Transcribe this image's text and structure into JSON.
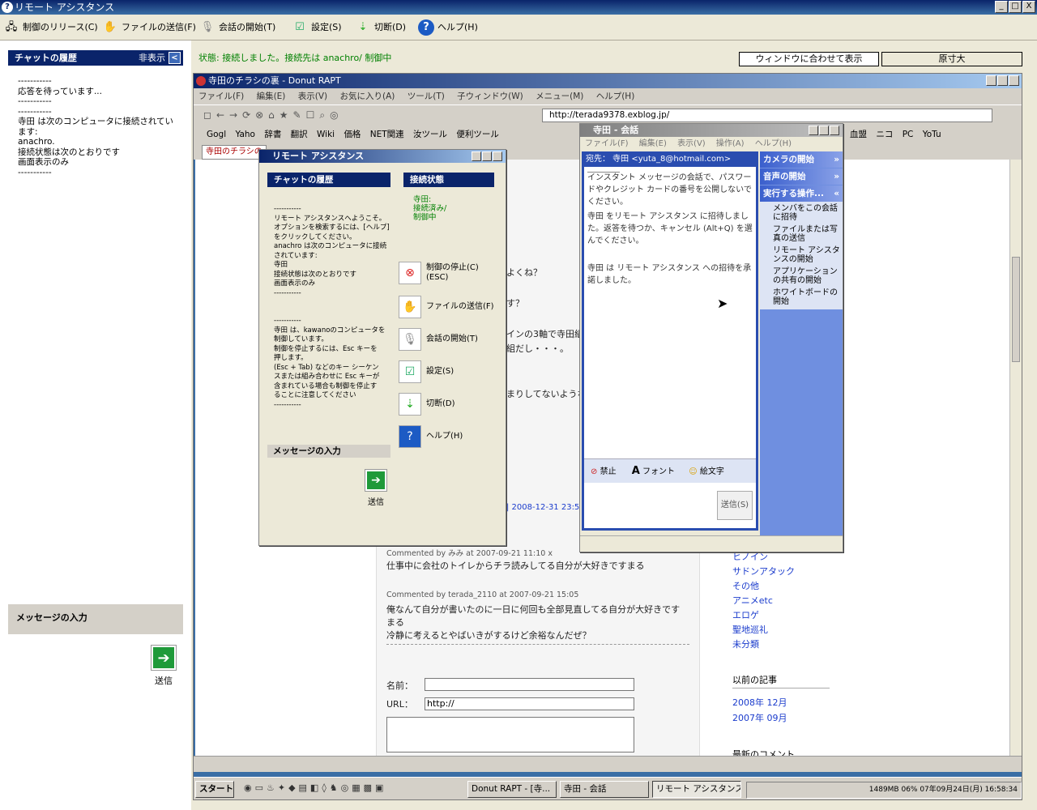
{
  "window": {
    "title": "リモート アシスタンス",
    "min": "_",
    "max": "□",
    "close": "X"
  },
  "main_toolbar": {
    "release": "制御のリリース(C)",
    "send_file": "ファイルの送信(F)",
    "start_conv": "会話の開始(T)",
    "settings": "設定(S)",
    "disconnect": "切断(D)",
    "help": "ヘルプ(H)"
  },
  "left_panel": {
    "header": "チャットの履歴",
    "hide": "非表示",
    "hide_arrow": "<",
    "chat_log": "-----------\n応答を待っています...\n-----------\n-----------\n寺田 は次のコンピュータに接続されています:\nanachro.\n接続状態は次のとおりです\n画面表示のみ\n-----------",
    "message_header": "メッセージの入力",
    "send_label": "送信",
    "send_arrow": "➔"
  },
  "status": {
    "text": "状態: 接続しました。接続先は anachro/ 制御中",
    "fit_button": "ウィンドウに合わせて表示",
    "actual_button": "原寸大"
  },
  "donut": {
    "title": "寺田のチラシの裏 - Donut RAPT",
    "menu": [
      "ファイル(F)",
      "編集(E)",
      "表示(V)",
      "お気に入り(A)",
      "ツール(T)",
      "子ウィンドウ(W)",
      "メニュー(M)",
      "ヘルプ(H)"
    ],
    "address": "http://terada9378.exblog.jp/",
    "links": [
      "Gogl",
      "Yaho",
      "辞書",
      "翻訳",
      "Wiki",
      "価格",
      "NET関連",
      "汝ツール",
      "便利ツール",
      "血盟",
      "ニコ",
      "PC",
      "YoTu"
    ],
    "tab": "寺田のチラシの裏",
    "page_fragments": {
      "f1": "よくね？",
      "f2": "す？",
      "f3": "インの3軸で寺田組",
      "f4": "組だし・・・。",
      "f5": "まりしてないような",
      "date_link": "| 2008-12-31 23:59 | モ"
    },
    "comments": [
      {
        "by": "Commented by みみ at 2007-09-21 11:10 x",
        "text": "仕事中に会社のトイレからチラ読みしてる自分が大好きですまる"
      },
      {
        "by": "Commented by terada_2110 at 2007-09-21 15:05",
        "text": "俺なんて自分が書いたのに一日に何回も全部見直してる自分が大好きです　まる\n冷静に考えるとやばいきがするけど余裕なんだぜ？"
      }
    ],
    "form": {
      "name_label": "名前：",
      "url_label": "URL：",
      "url_value": "http://"
    },
    "categories": [
      "ヒノイン",
      "サドンアタック",
      "その他",
      "アニメetc",
      "エロゲ",
      "聖地巡礼",
      "未分類"
    ],
    "archive_title": "以前の記事",
    "archives": [
      "2008年 12月",
      "2007年 09月"
    ],
    "recent_comments": "最新のコメント"
  },
  "taskbar": {
    "start": "スタート",
    "tasks": [
      "Donut RAPT - [寺...",
      "寺田 - 会話",
      "リモート アシスタンス"
    ],
    "tray": "1489MB  06%  07年09月24日(月) 16:58:34"
  },
  "ra_inner": {
    "title": "リモート アシスタンス",
    "chat_header": "チャットの履歴",
    "status_header": "接続状態",
    "status_text": "寺田:\n接続済み/\n制御中",
    "chat_log": "-----------\nリモート アシスタンスへようこそ。\nオプションを検索するには、[ヘルプ]\nをクリックしてください。\nanachro は次のコンピュータに接続\nされています:\n寺田\n接続状態は次のとおりです\n画面表示のみ\n-----------\n\n\n-----------\n寺田 は、kawanoのコンピュータを\n制御しています。\n制御を停止するには、Esc キーを\n押します。\n(Esc + Tab) などのキー シーケン\nスまたは組み合わせに Esc キーが\n含まれている場合も制御を停止す\nることに注意してください\n-----------",
    "buttons": [
      "制御の停止(C)\n(ESC)",
      "ファイルの送信(F)",
      "会話の開始(T)",
      "設定(S)",
      "切断(D)",
      "ヘルプ(H)"
    ],
    "msg_header": "メッセージの入力",
    "send": "送信"
  },
  "conversation": {
    "title": "寺田 - 会話",
    "menu": [
      "ファイル(F)",
      "編集(E)",
      "表示(V)",
      "操作(A)",
      "ヘルプ(H)"
    ],
    "to": "宛先： 寺田 <yuta_8@hotmail.com>",
    "messages": [
      "インスタント メッセージの会話で、パスワードやクレジット カードの番号を公開しないでください。",
      "寺田 をリモート アシスタンス に招待しました。返答を待つか、キャンセル (Alt+Q) を選んでください。",
      "寺田 は リモート アシスタンス への招待を承諾しました。"
    ],
    "block": "禁止",
    "font": "フォント",
    "emoticon": "絵文字",
    "send": "送信(S)",
    "side": {
      "camera": "カメラの開始",
      "voice": "音声の開始",
      "actions": "実行する操作...",
      "items": [
        "メンバをこの会話に招待",
        "ファイルまたは写真の送信",
        "リモート アシスタンスの開始",
        "アプリケーションの共有の開始",
        "ホワイトボードの開始"
      ]
    }
  },
  "colors": {
    "accent": "#0a246a",
    "status_green": "#008000"
  }
}
